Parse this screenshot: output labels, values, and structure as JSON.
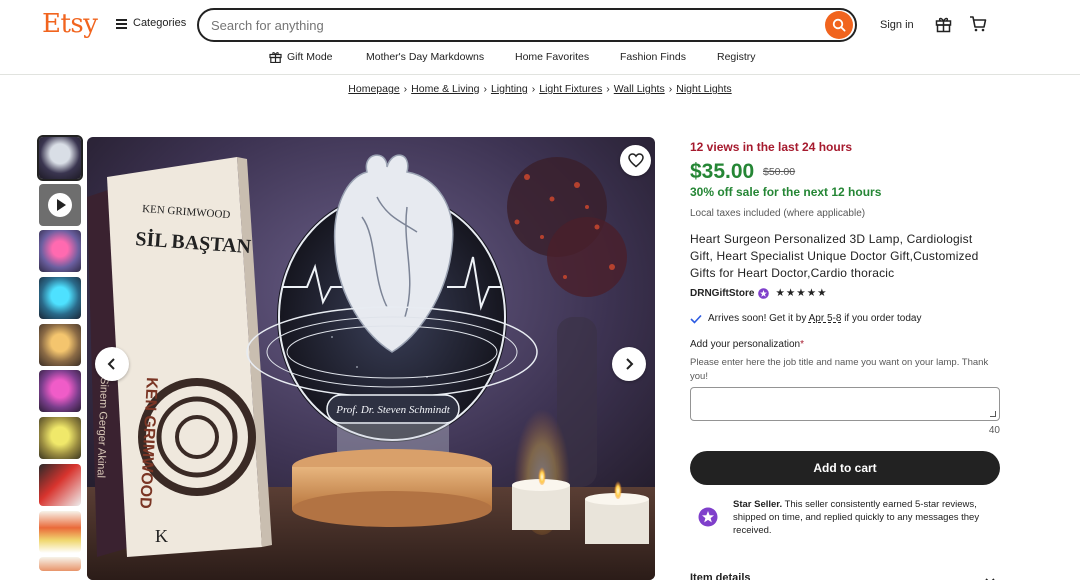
{
  "header": {
    "logo": "Etsy",
    "categories_label": "Categories",
    "search_placeholder": "Search for anything",
    "signin_label": "Sign in"
  },
  "nav": {
    "items": [
      "Gift Mode",
      "Mother's Day Markdowns",
      "Home Favorites",
      "Fashion Finds",
      "Registry"
    ]
  },
  "breadcrumb": [
    "Homepage",
    "Home & Living",
    "Lighting",
    "Light Fixtures",
    "Wall Lights",
    "Night Lights"
  ],
  "product": {
    "views": "12 views in the last 24 hours",
    "price": "$35.00",
    "old_price": "$50.00",
    "sale": "30% off sale for the next 12 hours",
    "taxes": "Local taxes included (where applicable)",
    "title": "Heart Surgeon Personalized 3D Lamp, Cardiologist Gift, Heart Specialist Unique Doctor Gift,Customized Gifts for Heart Doctor,Cardio thoracic",
    "store": "DRNGiftStore",
    "stars": "★★★★★",
    "arrives_prefix": "Arrives soon! Get it by",
    "arrives_dates": "Apr 5-8",
    "arrives_suffix": "if you order today",
    "personalization_label": "Add your personalization",
    "personalization_required": "*",
    "personalization_hint": "Please enter here the job title and name you want on your lamp. Thank you!",
    "char_count": "40",
    "add_to_cart": "Add to cart",
    "star_seller_title": "Star Seller.",
    "star_seller_text": "This seller consistently earned 5-star reviews, shipped on time, and replied quickly to any messages they received.",
    "item_details": "Item details"
  },
  "image": {
    "book_author": "KEN GRIMWOOD",
    "book_title": "SİL BAŞTAN",
    "book2_author": "Sinem Gerger Akinal",
    "lamp_engraving": "Prof. Dr. Steven Schmindt",
    "book_letter": "K"
  },
  "colors": {
    "brand": "#f1641e",
    "price_green": "#258635",
    "urgency_red": "#a61a2e",
    "star_purple": "#7f3fcb"
  }
}
